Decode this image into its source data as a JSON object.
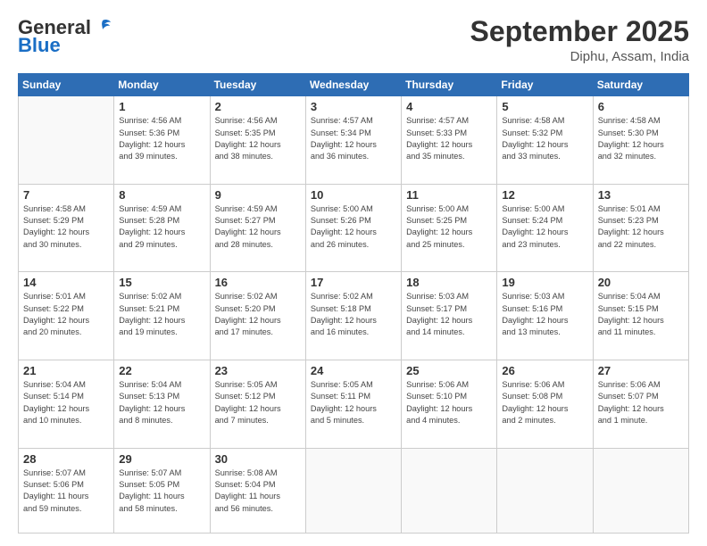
{
  "header": {
    "logo_general": "General",
    "logo_blue": "Blue",
    "month_title": "September 2025",
    "location": "Diphu, Assam, India"
  },
  "days_of_week": [
    "Sunday",
    "Monday",
    "Tuesday",
    "Wednesday",
    "Thursday",
    "Friday",
    "Saturday"
  ],
  "weeks": [
    [
      {
        "day": "",
        "info": ""
      },
      {
        "day": "1",
        "info": "Sunrise: 4:56 AM\nSunset: 5:36 PM\nDaylight: 12 hours\nand 39 minutes."
      },
      {
        "day": "2",
        "info": "Sunrise: 4:56 AM\nSunset: 5:35 PM\nDaylight: 12 hours\nand 38 minutes."
      },
      {
        "day": "3",
        "info": "Sunrise: 4:57 AM\nSunset: 5:34 PM\nDaylight: 12 hours\nand 36 minutes."
      },
      {
        "day": "4",
        "info": "Sunrise: 4:57 AM\nSunset: 5:33 PM\nDaylight: 12 hours\nand 35 minutes."
      },
      {
        "day": "5",
        "info": "Sunrise: 4:58 AM\nSunset: 5:32 PM\nDaylight: 12 hours\nand 33 minutes."
      },
      {
        "day": "6",
        "info": "Sunrise: 4:58 AM\nSunset: 5:30 PM\nDaylight: 12 hours\nand 32 minutes."
      }
    ],
    [
      {
        "day": "7",
        "info": "Sunrise: 4:58 AM\nSunset: 5:29 PM\nDaylight: 12 hours\nand 30 minutes."
      },
      {
        "day": "8",
        "info": "Sunrise: 4:59 AM\nSunset: 5:28 PM\nDaylight: 12 hours\nand 29 minutes."
      },
      {
        "day": "9",
        "info": "Sunrise: 4:59 AM\nSunset: 5:27 PM\nDaylight: 12 hours\nand 28 minutes."
      },
      {
        "day": "10",
        "info": "Sunrise: 5:00 AM\nSunset: 5:26 PM\nDaylight: 12 hours\nand 26 minutes."
      },
      {
        "day": "11",
        "info": "Sunrise: 5:00 AM\nSunset: 5:25 PM\nDaylight: 12 hours\nand 25 minutes."
      },
      {
        "day": "12",
        "info": "Sunrise: 5:00 AM\nSunset: 5:24 PM\nDaylight: 12 hours\nand 23 minutes."
      },
      {
        "day": "13",
        "info": "Sunrise: 5:01 AM\nSunset: 5:23 PM\nDaylight: 12 hours\nand 22 minutes."
      }
    ],
    [
      {
        "day": "14",
        "info": "Sunrise: 5:01 AM\nSunset: 5:22 PM\nDaylight: 12 hours\nand 20 minutes."
      },
      {
        "day": "15",
        "info": "Sunrise: 5:02 AM\nSunset: 5:21 PM\nDaylight: 12 hours\nand 19 minutes."
      },
      {
        "day": "16",
        "info": "Sunrise: 5:02 AM\nSunset: 5:20 PM\nDaylight: 12 hours\nand 17 minutes."
      },
      {
        "day": "17",
        "info": "Sunrise: 5:02 AM\nSunset: 5:18 PM\nDaylight: 12 hours\nand 16 minutes."
      },
      {
        "day": "18",
        "info": "Sunrise: 5:03 AM\nSunset: 5:17 PM\nDaylight: 12 hours\nand 14 minutes."
      },
      {
        "day": "19",
        "info": "Sunrise: 5:03 AM\nSunset: 5:16 PM\nDaylight: 12 hours\nand 13 minutes."
      },
      {
        "day": "20",
        "info": "Sunrise: 5:04 AM\nSunset: 5:15 PM\nDaylight: 12 hours\nand 11 minutes."
      }
    ],
    [
      {
        "day": "21",
        "info": "Sunrise: 5:04 AM\nSunset: 5:14 PM\nDaylight: 12 hours\nand 10 minutes."
      },
      {
        "day": "22",
        "info": "Sunrise: 5:04 AM\nSunset: 5:13 PM\nDaylight: 12 hours\nand 8 minutes."
      },
      {
        "day": "23",
        "info": "Sunrise: 5:05 AM\nSunset: 5:12 PM\nDaylight: 12 hours\nand 7 minutes."
      },
      {
        "day": "24",
        "info": "Sunrise: 5:05 AM\nSunset: 5:11 PM\nDaylight: 12 hours\nand 5 minutes."
      },
      {
        "day": "25",
        "info": "Sunrise: 5:06 AM\nSunset: 5:10 PM\nDaylight: 12 hours\nand 4 minutes."
      },
      {
        "day": "26",
        "info": "Sunrise: 5:06 AM\nSunset: 5:08 PM\nDaylight: 12 hours\nand 2 minutes."
      },
      {
        "day": "27",
        "info": "Sunrise: 5:06 AM\nSunset: 5:07 PM\nDaylight: 12 hours\nand 1 minute."
      }
    ],
    [
      {
        "day": "28",
        "info": "Sunrise: 5:07 AM\nSunset: 5:06 PM\nDaylight: 11 hours\nand 59 minutes."
      },
      {
        "day": "29",
        "info": "Sunrise: 5:07 AM\nSunset: 5:05 PM\nDaylight: 11 hours\nand 58 minutes."
      },
      {
        "day": "30",
        "info": "Sunrise: 5:08 AM\nSunset: 5:04 PM\nDaylight: 11 hours\nand 56 minutes."
      },
      {
        "day": "",
        "info": ""
      },
      {
        "day": "",
        "info": ""
      },
      {
        "day": "",
        "info": ""
      },
      {
        "day": "",
        "info": ""
      }
    ]
  ]
}
